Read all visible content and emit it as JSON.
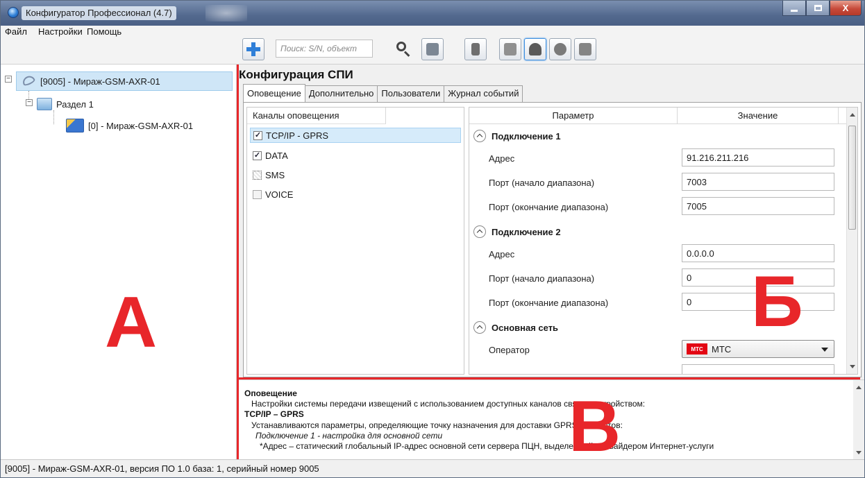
{
  "window": {
    "title": "Конфигуратор Профессионал (4.7)",
    "buttons": {
      "minimize": "",
      "maximize": "",
      "close": "X"
    }
  },
  "menu": {
    "items": [
      "Файл",
      "Настройки",
      "Помощь"
    ]
  },
  "toolbar": {
    "search_placeholder": "Поиск: S/N, объект",
    "icons": [
      "add-icon",
      "search-icon",
      "user-computer-icon",
      "usb-icon",
      "ethernet-icon",
      "wifi-icon",
      "globe-icon",
      "modem-icon"
    ]
  },
  "tree": {
    "root": "[9005] - Мираж-GSM-AXR-01",
    "section": "Раздел 1",
    "device": "[0] - Мираж-GSM-AXR-01",
    "expander_symbol": "−"
  },
  "annotations": {
    "a": "А",
    "b": "Б",
    "c": "В"
  },
  "content": {
    "title": "Конфигурация СПИ",
    "tabs": [
      "Оповещение",
      "Дополнительно",
      "Пользователи",
      "Журнал событий"
    ],
    "channels_header": "Каналы оповещения",
    "channels": [
      {
        "label": "TCP/IP - GPRS",
        "state": "checked",
        "mark": "✓"
      },
      {
        "label": "DATA",
        "state": "checked",
        "mark": "✓"
      },
      {
        "label": "SMS",
        "state": "indeterminate",
        "mark": ""
      },
      {
        "label": "VOICE",
        "state": "unchecked",
        "mark": ""
      }
    ],
    "params_header": {
      "param": "Параметр",
      "value": "Значение"
    },
    "groups": [
      {
        "title": "Подключение 1",
        "rows": [
          {
            "label": "Адрес",
            "value": "91.216.211.216"
          },
          {
            "label": "Порт (начало диапазона)",
            "value": "7003"
          },
          {
            "label": "Порт (окончание диапазона)",
            "value": "7005"
          }
        ]
      },
      {
        "title": "Подключение 2",
        "rows": [
          {
            "label": "Адрес",
            "value": "0.0.0.0"
          },
          {
            "label": "Порт (начало диапазона)",
            "value": "0"
          },
          {
            "label": "Порт (окончание диапазона)",
            "value": "0"
          }
        ]
      },
      {
        "title": "Основная сеть",
        "rows": [
          {
            "label": "Оператор",
            "value": "МТС",
            "logo": "МТС"
          }
        ]
      }
    ]
  },
  "help": {
    "lines": [
      "Оповещение",
      "Настройки системы передачи извещений с использованием доступных каналов связи с устройством:",
      "TCP/IP – GPRS",
      "Устанавливаются параметры, определяющие точку назначения для доставки GPRS IP-пакетов:",
      "Подключение 1 - настройка для основной сети",
      "*Адрес – статический глобальный IP-адрес основной сети сервера ПЦН, выделенный провайдером Интернет-услуги"
    ]
  },
  "status": {
    "text": "[9005] - Мираж-GSM-AXR-01, версия ПО 1.0 база: 1, серийный номер 9005"
  },
  "colors": {
    "annotation_red": "#e8262a",
    "selection": "#cfe6f7",
    "mts_red": "#e30613"
  }
}
